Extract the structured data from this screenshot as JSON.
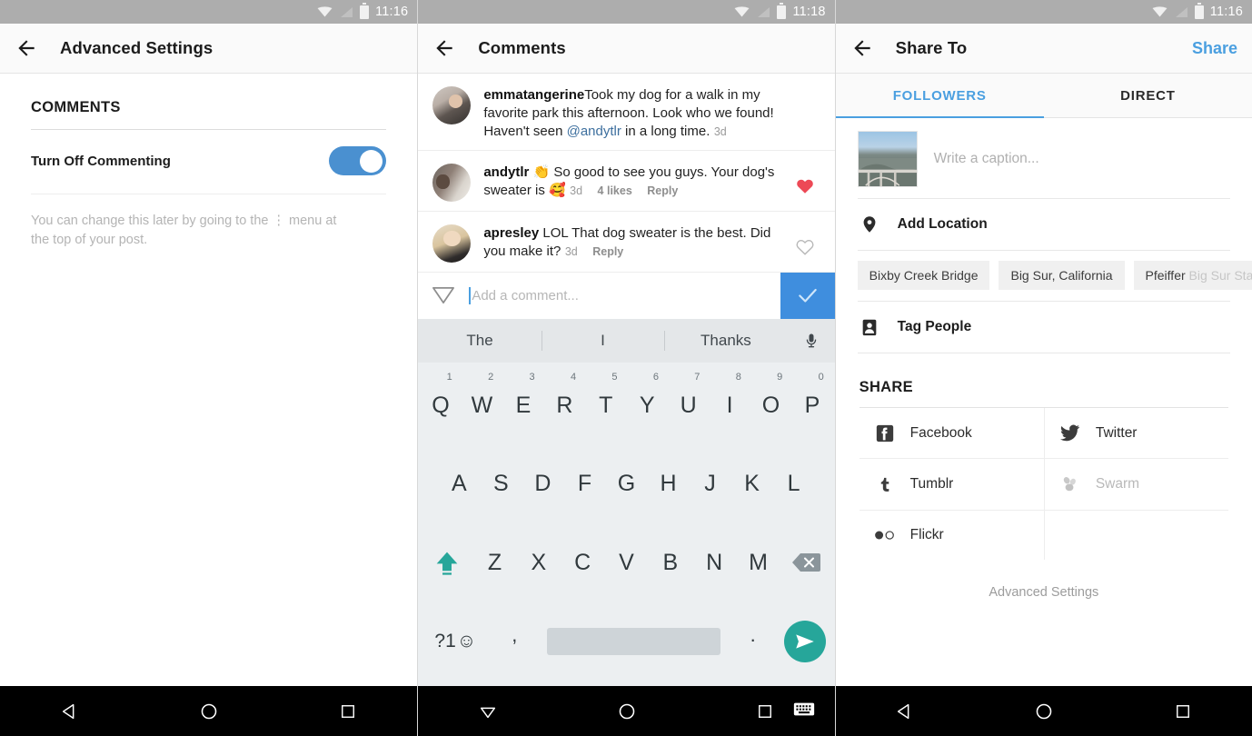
{
  "screens": {
    "left": {
      "statusbar": {
        "time": "11:16"
      },
      "appbar": {
        "title": "Advanced Settings"
      },
      "section_title": "COMMENTS",
      "setting": {
        "label": "Turn Off Commenting",
        "toggle_on": true,
        "toggle_color": "#4a90d0"
      },
      "helper_before": "You can change this later by going to the",
      "helper_kebab": "⋮",
      "helper_after": "menu at the top of your post.",
      "navbar": {
        "back": "back-triangle",
        "home": "home-circle",
        "recents": "recents-square"
      }
    },
    "middle": {
      "statusbar": {
        "time": "11:18"
      },
      "appbar": {
        "title": "Comments"
      },
      "comments": [
        {
          "username": "emmatangerine",
          "text_before": "Took my dog for a walk in my favorite park this afternoon. Look who we found! Haven't seen ",
          "mention": "@andytlr",
          "text_after": " in a long time.",
          "time": "3d",
          "likes": "",
          "reply": "",
          "liked": false,
          "show_like": false
        },
        {
          "username": "andytlr",
          "text_before": " 👏 So good to see you guys. Your dog's sweater is 🥰",
          "mention": "",
          "text_after": "",
          "time": "3d",
          "likes": "4 likes",
          "reply": "Reply",
          "liked": true,
          "show_like": true
        },
        {
          "username": "apresley",
          "text_before": " LOL That dog sweater is the best. Did you make it?",
          "mention": "",
          "text_after": "",
          "time": "3d",
          "likes": "",
          "reply": "Reply",
          "liked": false,
          "show_like": true
        }
      ],
      "compose": {
        "placeholder": "Add a comment...",
        "submit_color": "#3f8ede"
      },
      "keyboard": {
        "suggestions": [
          "The",
          "I",
          "Thanks"
        ],
        "row1": [
          {
            "letter": "Q",
            "num": "1"
          },
          {
            "letter": "W",
            "num": "2"
          },
          {
            "letter": "E",
            "num": "3"
          },
          {
            "letter": "R",
            "num": "4"
          },
          {
            "letter": "T",
            "num": "5"
          },
          {
            "letter": "Y",
            "num": "6"
          },
          {
            "letter": "U",
            "num": "7"
          },
          {
            "letter": "I",
            "num": "8"
          },
          {
            "letter": "O",
            "num": "9"
          },
          {
            "letter": "P",
            "num": "0"
          }
        ],
        "row2": [
          "A",
          "S",
          "D",
          "F",
          "G",
          "H",
          "J",
          "K",
          "L"
        ],
        "row3": [
          "Z",
          "X",
          "C",
          "V",
          "B",
          "N",
          "M"
        ],
        "symbols_key": "?1",
        "emoji_key": "☺",
        "comma_key": ",",
        "period_key": ".",
        "shift_color": "#26a69a",
        "send_color": "#26a69a"
      },
      "navbar": {
        "back": "back-triangle-down",
        "home": "home-circle",
        "recents": "recents-square",
        "keyboard": "keyboard-icon"
      }
    },
    "right": {
      "statusbar": {
        "time": "11:16"
      },
      "appbar": {
        "title": "Share To",
        "action": "Share",
        "action_color": "#4a9fe0"
      },
      "tabs": [
        {
          "label": "FOLLOWERS",
          "active": true
        },
        {
          "label": "DIRECT",
          "active": false
        }
      ],
      "caption_placeholder": "Write a caption...",
      "add_location_label": "Add Location",
      "location_chips": [
        {
          "text": "Bixby Creek Bridge",
          "faded_tail": ""
        },
        {
          "text": "Big Sur, California",
          "faded_tail": ""
        },
        {
          "text": "Pfeiffer",
          "faded_tail": " Big Sur State Park"
        }
      ],
      "tag_people_label": "Tag People",
      "share_section_title": "SHARE",
      "share_targets": [
        {
          "label": "Facebook",
          "icon": "facebook-icon",
          "disabled": false
        },
        {
          "label": "Twitter",
          "icon": "twitter-icon",
          "disabled": false
        },
        {
          "label": "Tumblr",
          "icon": "tumblr-icon",
          "disabled": false
        },
        {
          "label": "Swarm",
          "icon": "swarm-icon",
          "disabled": true
        },
        {
          "label": "Flickr",
          "icon": "flickr-icon",
          "disabled": false
        }
      ],
      "advanced_settings_link": "Advanced Settings",
      "navbar": {
        "back": "back-triangle",
        "home": "home-circle",
        "recents": "recents-square"
      }
    }
  }
}
